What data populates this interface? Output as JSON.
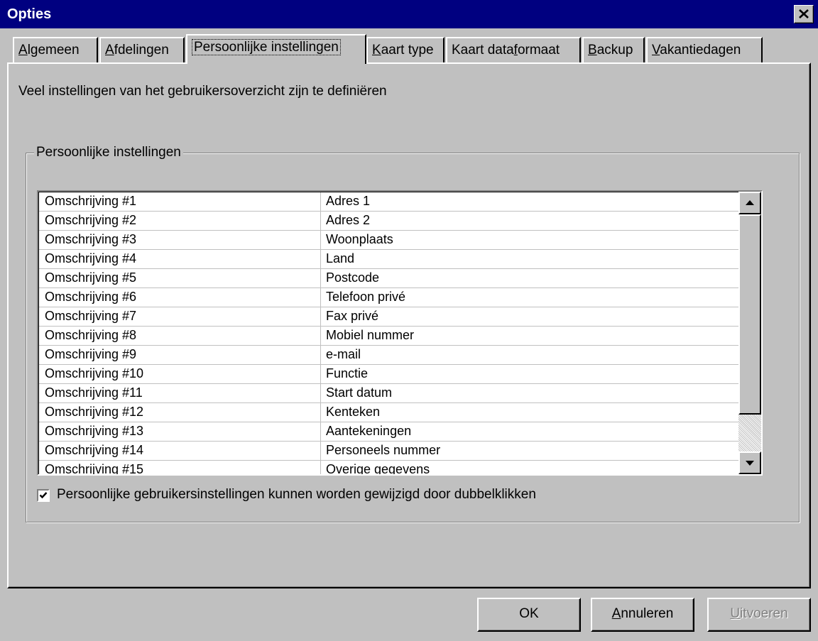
{
  "window": {
    "title": "Opties"
  },
  "tabs": [
    {
      "label": "Algemeen",
      "active": false
    },
    {
      "label": "Afdelingen",
      "active": false
    },
    {
      "label": "Persoonlijke instellingen",
      "active": true
    },
    {
      "label": "Kaart type",
      "active": false
    },
    {
      "label": "Kaart dataformaat",
      "active": false
    },
    {
      "label": "Backup",
      "active": false
    },
    {
      "label": "Vakantiedagen",
      "active": false
    }
  ],
  "panel": {
    "description": "Veel instellingen van het gebruikersoverzicht zijn te definiëren",
    "group_title": "Persoonlijke instellingen",
    "rows": [
      {
        "key": "Omschrijving #1",
        "value": "Adres 1"
      },
      {
        "key": "Omschrijving #2",
        "value": "Adres 2"
      },
      {
        "key": "Omschrijving #3",
        "value": "Woonplaats"
      },
      {
        "key": "Omschrijving #4",
        "value": "Land"
      },
      {
        "key": "Omschrijving #5",
        "value": "Postcode"
      },
      {
        "key": "Omschrijving #6",
        "value": "Telefoon privé"
      },
      {
        "key": "Omschrijving #7",
        "value": "Fax privé"
      },
      {
        "key": "Omschrijving #8",
        "value": "Mobiel nummer"
      },
      {
        "key": "Omschrijving #9",
        "value": "e-mail"
      },
      {
        "key": "Omschrijving #10",
        "value": "Functie"
      },
      {
        "key": "Omschrijving #11",
        "value": "Start datum"
      },
      {
        "key": "Omschrijving #12",
        "value": "Kenteken"
      },
      {
        "key": "Omschrijving #13",
        "value": "Aantekeningen"
      },
      {
        "key": "Omschrijving #14",
        "value": "Personeels nummer"
      },
      {
        "key": "Omschrijving #15",
        "value": "Overige gegevens"
      }
    ],
    "checkbox_label": "Persoonlijke gebruikersinstellingen kunnen worden gewijzigd door dubbelklikken",
    "checkbox_checked": true
  },
  "buttons": {
    "ok": "OK",
    "cancel": "Annuleren",
    "apply": "Uitvoeren",
    "apply_enabled": false
  },
  "colors": {
    "titlebar": "#000080",
    "face": "#c0c0c0",
    "list_bg": "#ffffff"
  }
}
